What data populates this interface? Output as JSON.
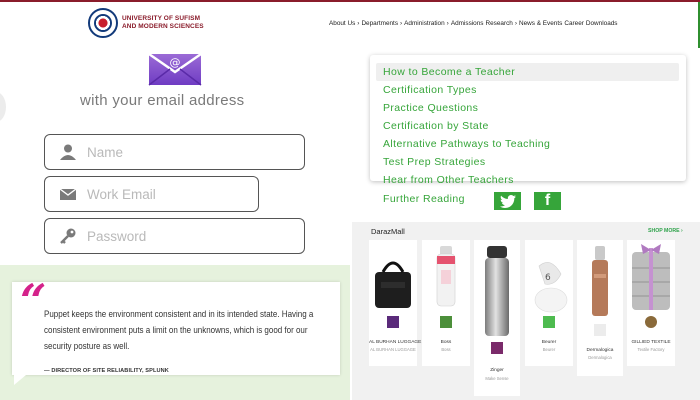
{
  "header": {
    "logo_line1": "UNIVERSITY OF SUFISM",
    "logo_line2": "AND MODERN SCIENCES",
    "nav": [
      "About Us",
      "Departments",
      "Administration",
      "Admissions",
      "Research",
      "News & Events",
      "Career",
      "Downloads"
    ],
    "nav_sep": "›"
  },
  "signup": {
    "heading": "with your email address",
    "name_placeholder": "Name",
    "work_email_placeholder": "Work Email",
    "password_placeholder": "Password"
  },
  "testimonial": {
    "quote": "Puppet keeps the environment consistent and in its intended state. Having a consistent environment puts a limit on the unknowns, which is good for our security posture as well.",
    "author": "— DIRECTOR OF SITE RELIABILITY, SPLUNK"
  },
  "menu": {
    "items": [
      "How to Become a Teacher",
      "Certification Types",
      "Practice Questions",
      "Certification by State",
      "Alternative Pathways to Teaching",
      "Test Prep Strategies",
      "Hear from Other Teachers"
    ],
    "further_reading": "Further Reading",
    "accent": "#36a53a"
  },
  "mall": {
    "title": "DarazMall",
    "shop_more": "SHOP MORE ›",
    "products": [
      {
        "name": "AL BURHAN LUGGAGE",
        "sub": "AL BURHAN LUGGAGE"
      },
      {
        "name": "Boss",
        "sub": "Boss"
      },
      {
        "name": "Zinger",
        "sub": "Make Sense"
      },
      {
        "name": "Beurer",
        "sub": "Beurer"
      },
      {
        "name": "Dermalogica",
        "sub": "Dermalogica"
      },
      {
        "name": "GILLIED TEXTILE",
        "sub": "Textile Factory"
      }
    ]
  }
}
